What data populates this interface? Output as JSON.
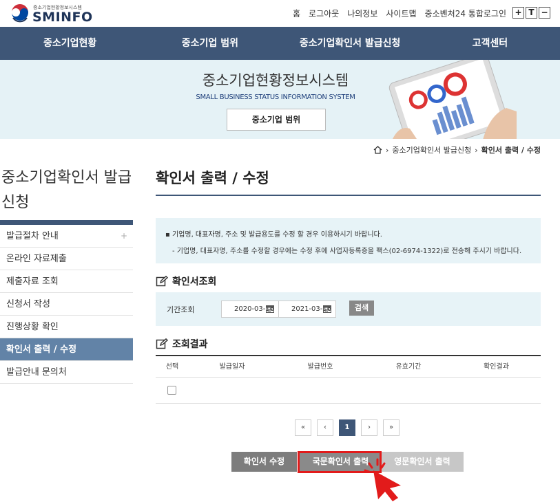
{
  "header": {
    "logo_sub": "중소기업현황정보시스템",
    "logo_main": "SMINFO",
    "links": [
      "홈",
      "로그아웃",
      "나의정보",
      "사이트맵",
      "중소벤처24 통합로그인"
    ],
    "font_controls": [
      "+",
      "T",
      "−"
    ]
  },
  "nav": [
    "중소기업현황",
    "중소기업 범위",
    "중소기업확인서 발급신청",
    "고객센터"
  ],
  "banner": {
    "title": "중소기업현황정보시스템",
    "subtitle": "SMALL BUSINESS STATUS INFORMATION SYSTEM",
    "button": "중소기업 범위"
  },
  "breadcrumb": {
    "home_icon": "home-icon",
    "items": [
      "중소기업확인서 발급신청",
      "확인서 출력 / 수정"
    ]
  },
  "sidebar": {
    "title": "중소기업확인서 발급신청",
    "items": [
      {
        "label": "발급절차 안내"
      },
      {
        "label": "온라인 자료제출"
      },
      {
        "label": "제출자료 조회"
      },
      {
        "label": "신청서 작성"
      },
      {
        "label": "진행상황 확인"
      },
      {
        "label": "확인서 출력 / 수정"
      },
      {
        "label": "발급안내 문의처"
      }
    ]
  },
  "main": {
    "title": "확인서 출력 / 수정",
    "notices": [
      "기업명, 대표자명, 주소 및 발급용도를 수정 할 경우 이용하시기 바랍니다.",
      "- 기업명, 대표자명, 주소를 수정할 경우에는 수정 후에 사업자등록증을 팩스(02-6974-1322)로 전송해 주시기 바랍니다."
    ],
    "search_section": {
      "heading": "확인서조회",
      "period_label": "기간조회",
      "start_date": "2020-03-16",
      "end_date": "2021-03-16",
      "search_button": "검색"
    },
    "results_section": {
      "heading": "조회결과",
      "columns": [
        "선택",
        "발급일자",
        "발급번호",
        "유효기간",
        "확인결과"
      ]
    },
    "pagination": {
      "first": "«",
      "prev": "‹",
      "current": "1",
      "next": "›",
      "last": "»"
    },
    "buttons": {
      "edit": "확인서 수정",
      "print_korean": "국문확인서 출력",
      "print_english": "영문확인서 출력"
    }
  },
  "colors": {
    "nav_bg": "#3e5677",
    "banner_bg": "#e5f2f6",
    "sidebar_active": "#6283a7",
    "highlight": "#e21b1b"
  }
}
